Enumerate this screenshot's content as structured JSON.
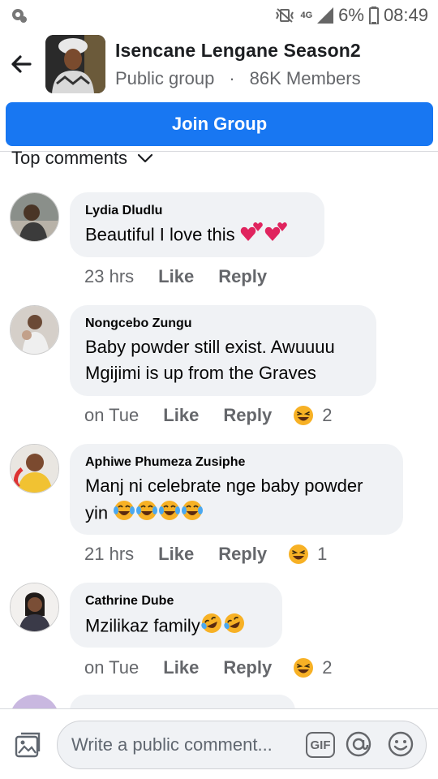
{
  "status_bar": {
    "network": "4G",
    "battery": "6%",
    "time": "08:49"
  },
  "header": {
    "title": "Isencane Lengane Season2",
    "privacy": "Public group",
    "separator": "·",
    "members": "86K Members"
  },
  "join_button": "Join Group",
  "sort": {
    "label": "Top comments"
  },
  "comments": [
    {
      "name": "Lydia Dludlu",
      "text": "Beautiful I love this",
      "emojis": [
        "two-hearts",
        "two-hearts"
      ],
      "time": "23 hrs",
      "like": "Like",
      "reply": "Reply",
      "reaction_count": ""
    },
    {
      "name": "Nongcebo Zungu",
      "text_lines": [
        "Baby powder still exist. Awuuuu",
        "Mgijimi is up from  the  Graves"
      ],
      "time": "on Tue",
      "like": "Like",
      "reply": "Reply",
      "reaction": "laughing-face",
      "reaction_count": "2"
    },
    {
      "name": "Aphiwe Phumeza Zusiphe",
      "text_lines": [
        "Manj ni celebrate nge baby powder",
        "yin"
      ],
      "emojis": [
        "tears-of-joy",
        "tears-of-joy",
        "tears-of-joy",
        "tears-of-joy"
      ],
      "time": "21 hrs",
      "like": "Like",
      "reply": "Reply",
      "reaction": "laughing-face",
      "reaction_count": "1"
    },
    {
      "name": "Cathrine Dube",
      "text": "Mzilikaz family",
      "emojis": [
        "rolling-laughing",
        "rolling-laughing"
      ],
      "time": "on Tue",
      "like": "Like",
      "reply": "Reply",
      "reaction": "laughing-face",
      "reaction_count": "2"
    }
  ],
  "composer": {
    "placeholder": "Write a public comment...",
    "gif_label": "GIF"
  },
  "colors": {
    "accent": "#1877f2",
    "bubble": "#f0f2f5",
    "secondary_text": "#65676b"
  }
}
